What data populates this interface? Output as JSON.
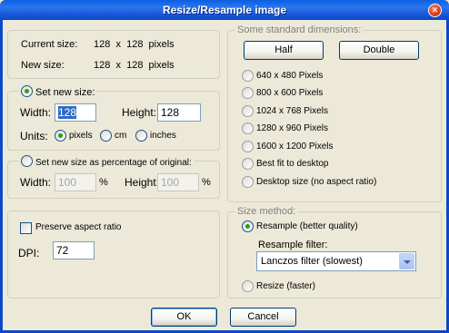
{
  "window": {
    "title": "Resize/Resample image"
  },
  "info": {
    "current_label": "Current size:",
    "current_value": "128  x  128  pixels",
    "new_label": "New size:",
    "new_value": "128  x  128  pixels"
  },
  "new_size": {
    "legend": "Set new size:",
    "width_label": "Width:",
    "width_value": "128",
    "height_label": "Height:",
    "height_value": "128",
    "units_label": "Units:",
    "unit_pixels": "pixels",
    "unit_cm": "cm",
    "unit_inches": "inches"
  },
  "percent": {
    "legend": "Set new size as percentage of original:",
    "width_label": "Width:",
    "width_value": "100",
    "height_label": "Height:",
    "height_value": "100",
    "pct_sign": "%"
  },
  "aspect": {
    "preserve_label": "Preserve aspect ratio",
    "dpi_label": "DPI:",
    "dpi_value": "72"
  },
  "standard": {
    "legend": "Some standard dimensions:",
    "half_label": "Half",
    "double_label": "Double",
    "options": [
      "640 x 480 Pixels",
      "800 x 600 Pixels",
      "1024 x 768 Pixels",
      "1280 x 960 Pixels",
      "1600 x 1200 Pixels",
      "Best fit to desktop",
      "Desktop size (no aspect ratio)"
    ]
  },
  "method": {
    "legend": "Size method:",
    "resample_label": "Resample (better quality)",
    "filter_label": "Resample filter:",
    "filter_value": "Lanczos filter (slowest)",
    "resize_label": "Resize (faster)"
  },
  "footer": {
    "ok_label": "OK",
    "cancel_label": "Cancel"
  },
  "colors": {
    "title_bar": "#0a5fe0",
    "dialog_bg": "#ece9d8",
    "selection": "#316ac5"
  }
}
